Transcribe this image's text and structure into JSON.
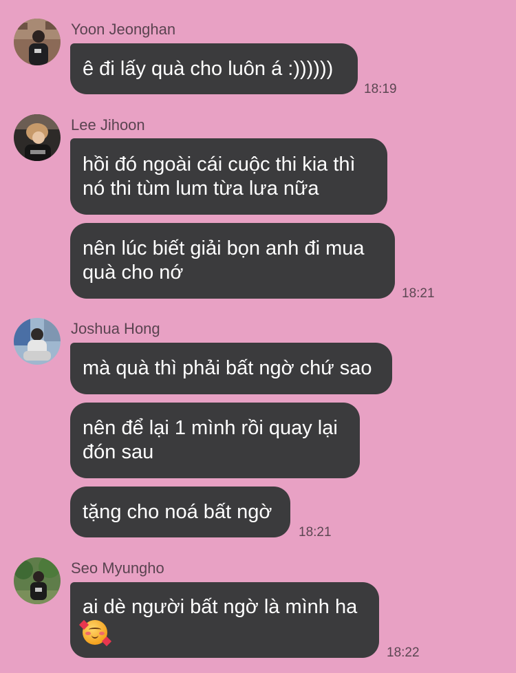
{
  "messages": [
    {
      "sender": "Yoon Jeonghan",
      "avatar_icon": "user-avatar-photo",
      "bubbles": [
        "ê đi lấy quà cho luôn á :))))))"
      ],
      "time": "18:19"
    },
    {
      "sender": "Lee Jihoon",
      "avatar_icon": "user-avatar-photo",
      "bubbles": [
        "hồi đó ngoài cái cuộc thi kia thì nó thi tùm lum từa lưa nữa",
        "nên lúc biết giải bọn anh đi mua quà cho nớ"
      ],
      "time": "18:21"
    },
    {
      "sender": "Joshua Hong",
      "avatar_icon": "user-avatar-photo",
      "bubbles": [
        "mà quà thì phải bất ngờ chứ sao",
        "nên để lại 1 mình rồi quay lại đón sau",
        "tặng cho noá bất ngờ"
      ],
      "time": "18:21"
    },
    {
      "sender": "Seo Myungho",
      "avatar_icon": "user-avatar-photo",
      "bubbles": [
        "ai dè người bất ngờ là mình ha"
      ],
      "emoji": "smiling-face-with-hearts",
      "time": "18:22"
    }
  ],
  "colors": {
    "background": "#e8a1c4",
    "bubble": "#3b3b3d",
    "bubble_text": "#ffffff",
    "meta_text": "#5a4350"
  }
}
